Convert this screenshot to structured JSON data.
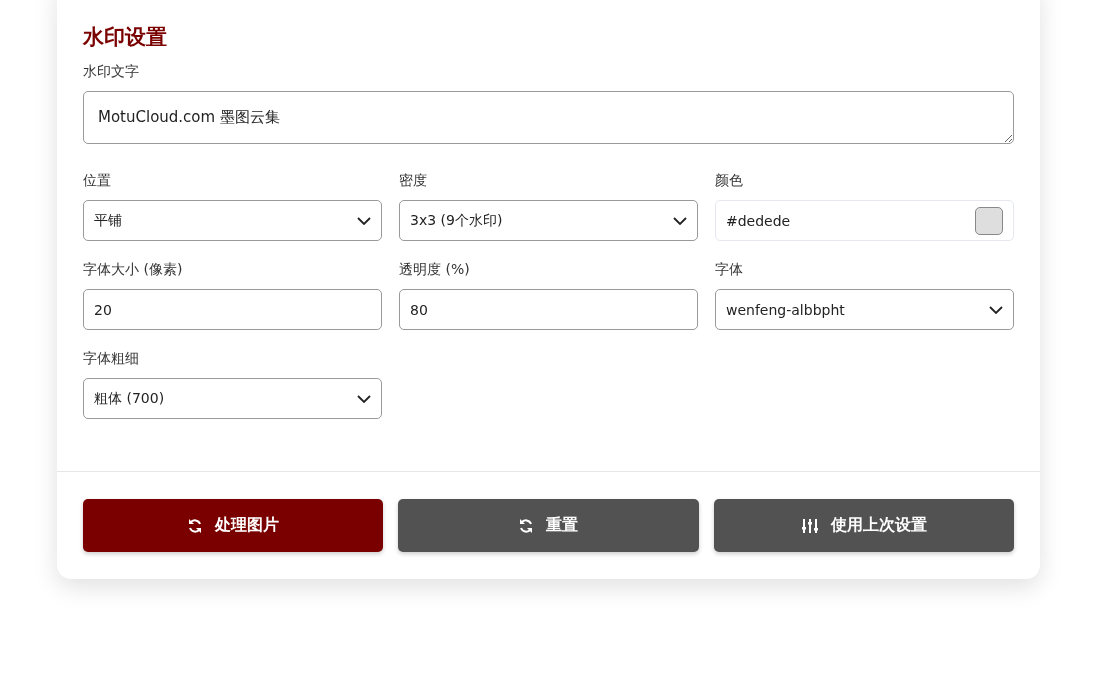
{
  "section_title": "水印设置",
  "watermark_text": {
    "label": "水印文字",
    "value": "MotuCloud.com 墨图云集"
  },
  "fields": [
    {
      "kind": "select",
      "label": "位置",
      "value": "平铺"
    },
    {
      "kind": "select",
      "label": "密度",
      "value": "3x3 (9个水印)"
    },
    {
      "kind": "color",
      "label": "颜色",
      "value": "#dedede",
      "color": "#dedede"
    },
    {
      "kind": "input",
      "label": "字体大小 (像素)",
      "value": "20"
    },
    {
      "kind": "input",
      "label": "透明度 (%)",
      "value": "80"
    },
    {
      "kind": "select",
      "label": "字体",
      "value": "wenfeng-albbpht"
    },
    {
      "kind": "select",
      "label": "字体粗细",
      "value": "粗体 (700)"
    }
  ],
  "buttons": [
    {
      "label": "处理图片",
      "kind": "primary"
    },
    {
      "label": "重置",
      "kind": "secondary"
    },
    {
      "label": "使用上次设置",
      "kind": "secondary"
    }
  ]
}
